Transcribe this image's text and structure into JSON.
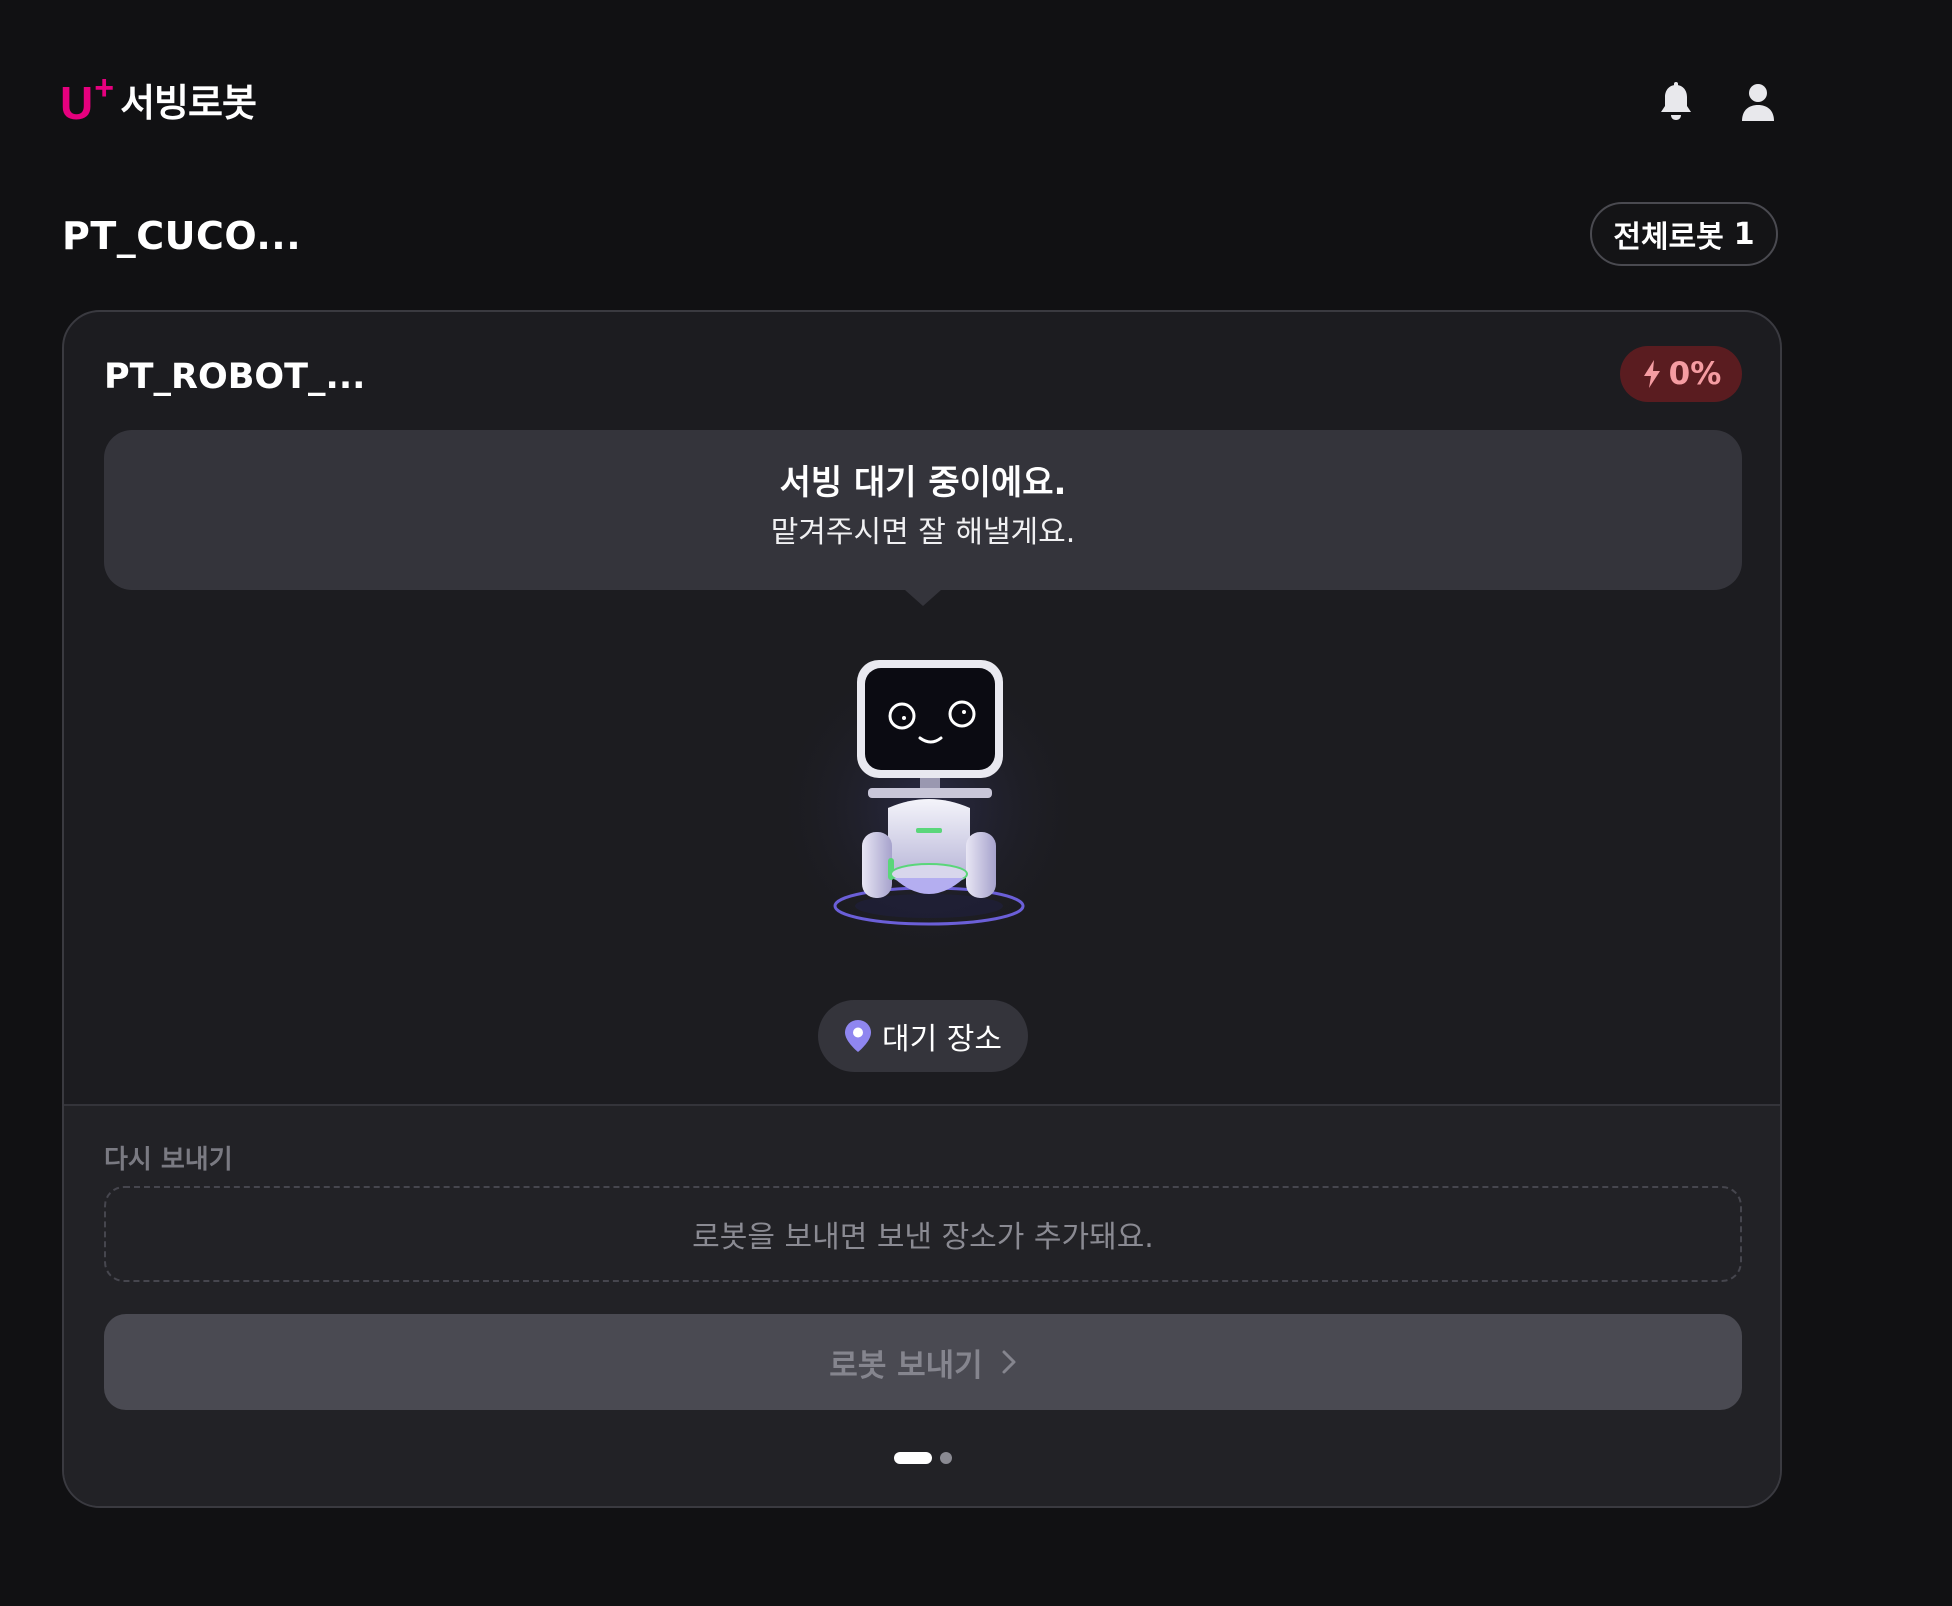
{
  "header": {
    "logo_u": "U",
    "logo_plus": "+",
    "logo_text": "서빙로봇",
    "brand_color": "#e6007e",
    "icons": [
      "bell-icon",
      "user-icon"
    ]
  },
  "store": {
    "name": "PT_CUCO...",
    "all_robots_label": "전체로봇",
    "all_robots_count": "1"
  },
  "robot_card": {
    "robot_name": "PT_ROBOT_...",
    "battery": {
      "icon": "lightning-icon",
      "value": "0%",
      "color": "#f59ca2"
    },
    "status_title": "서빙 대기 중이에요.",
    "status_sub": "맡겨주시면 잘 해낼게요.",
    "location": {
      "icon": "location-pin-icon",
      "label": "대기 장소",
      "pin_color": "#8f86f0"
    },
    "resend": {
      "label": "다시 보내기",
      "empty_text": "로봇을 보내면 보낸 장소가 추가돼요."
    },
    "send_button_label": "로봇 보내기",
    "pager": {
      "total": 2,
      "active": 1
    }
  }
}
